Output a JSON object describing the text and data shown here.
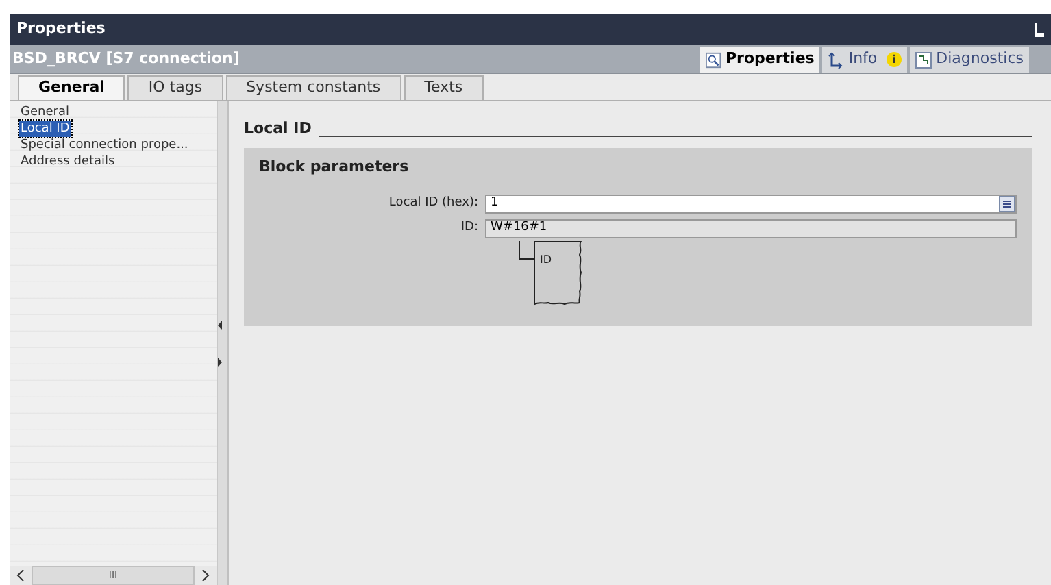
{
  "window": {
    "title": "Properties"
  },
  "object_title": "BSD_BRCV [S7 connection]",
  "view_tabs": [
    {
      "label": "Properties",
      "kind": "properties",
      "selected": true
    },
    {
      "label": "Info",
      "kind": "info",
      "badge": "i",
      "selected": false
    },
    {
      "label": "Diagnostics",
      "kind": "diagnostics",
      "selected": false
    }
  ],
  "tabs": [
    {
      "label": "General",
      "selected": true
    },
    {
      "label": "IO tags",
      "selected": false
    },
    {
      "label": "System constants",
      "selected": false
    },
    {
      "label": "Texts",
      "selected": false
    }
  ],
  "sidebar": {
    "items": [
      {
        "label": "General",
        "selected": false
      },
      {
        "label": "Local ID",
        "selected": true
      },
      {
        "label": "Special connection prope...",
        "selected": false
      },
      {
        "label": "Address details",
        "selected": false
      }
    ],
    "scroll_mark": "III"
  },
  "section": {
    "title": "Local ID",
    "group_title": "Block parameters",
    "fields": [
      {
        "kind": "input",
        "label": "Local ID (hex):",
        "value": "1"
      },
      {
        "kind": "readonly",
        "label": "ID:",
        "value": "W#16#1"
      }
    ],
    "block_pin": "ID"
  }
}
